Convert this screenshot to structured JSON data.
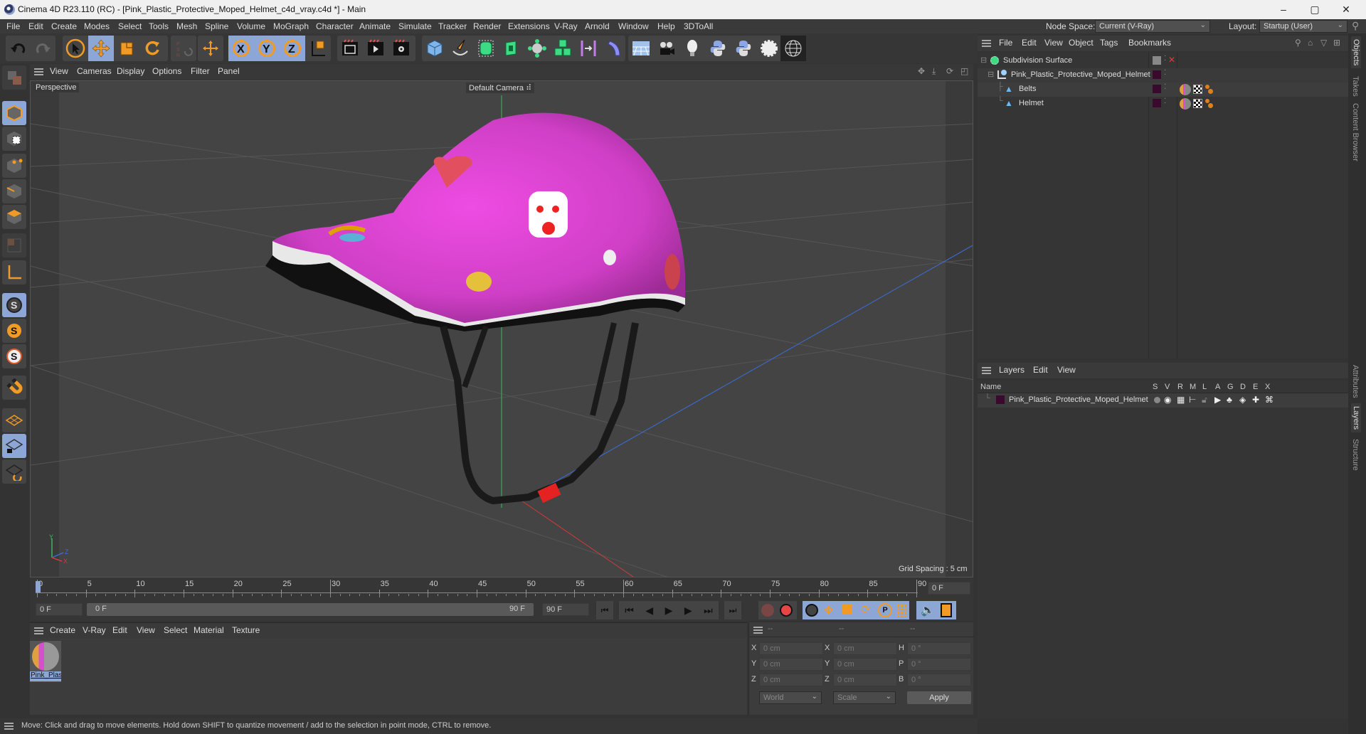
{
  "window": {
    "title": "Cinema 4D R23.110 (RC) - [Pink_Plastic_Protective_Moped_Helmet_c4d_vray.c4d *] - Main",
    "controls": {
      "minimize": "–",
      "maximize": "▢",
      "close": "✕"
    }
  },
  "menubar": {
    "items": [
      "File",
      "Edit",
      "Create",
      "Modes",
      "Select",
      "Tools",
      "Mesh",
      "Spline",
      "Volume",
      "MoGraph",
      "Character",
      "Animate",
      "Simulate",
      "Tracker",
      "Render",
      "Extensions",
      "V-Ray",
      "Arnold",
      "Window",
      "Help",
      "3DToAll"
    ],
    "node_space_label": "Node Space:",
    "node_space_value": "Current (V-Ray)",
    "layout_label": "Layout:",
    "layout_value": "Startup (User)"
  },
  "toolbar": {
    "tools": [
      "undo",
      "redo",
      "live-selection",
      "move",
      "scale",
      "rotate",
      "psr",
      "world-axis",
      "x-axis",
      "y-axis",
      "z-axis",
      "coordinate-system",
      "render-view",
      "render-to-picture-viewer",
      "render-settings",
      "cube",
      "pen",
      "subdivision-surface",
      "extrude",
      "cloner",
      "mograph-array",
      "symmetry",
      "deformer",
      "floor",
      "camera",
      "light",
      "python-1",
      "python-2",
      "settings-gear",
      "sphere-wireframe"
    ],
    "psr_label": "PSR"
  },
  "viewport": {
    "menu": [
      "View",
      "Cameras",
      "Display",
      "Options",
      "Filter",
      "Panel"
    ],
    "view_name": "Perspective",
    "camera_label": "Default Camera",
    "grid_spacing": "Grid Spacing : 5 cm",
    "axis_labels": {
      "x": "X",
      "y": "Y",
      "z": "Z"
    },
    "colors": {
      "helmet": "#d93fd0",
      "strap": "#1a1a1a",
      "buckle": "#e52222",
      "trim": "#e8e8e8"
    }
  },
  "timeline": {
    "ticks": [
      "0",
      "5",
      "10",
      "15",
      "20",
      "25",
      "30",
      "35",
      "40",
      "45",
      "50",
      "55",
      "60",
      "65",
      "70",
      "75",
      "80",
      "85",
      "90"
    ],
    "current_frame_right": "0 F",
    "start_field": "0 F",
    "range_start": "0 F",
    "range_end": "90 F",
    "end_field": "90 F",
    "playhead_value": 0
  },
  "material_manager": {
    "menu": [
      "Create",
      "V-Ray",
      "Edit",
      "View",
      "Select",
      "Material",
      "Texture"
    ],
    "materials": [
      {
        "name": "Pink_Plas"
      }
    ]
  },
  "coordinates": {
    "header": [
      "--",
      "--",
      "--"
    ],
    "position": [
      {
        "axis": "X",
        "value": "0 cm"
      },
      {
        "axis": "Y",
        "value": "0 cm"
      },
      {
        "axis": "Z",
        "value": "0 cm"
      }
    ],
    "size": [
      {
        "axis": "X",
        "value": "0 cm"
      },
      {
        "axis": "Y",
        "value": "0 cm"
      },
      {
        "axis": "Z",
        "value": "0 cm"
      }
    ],
    "rotation": [
      {
        "axis": "H",
        "value": "0 °"
      },
      {
        "axis": "P",
        "value": "0 °"
      },
      {
        "axis": "B",
        "value": "0 °"
      }
    ],
    "mode_select": "World",
    "size_select": "Scale",
    "apply_label": "Apply"
  },
  "status": {
    "text": "Move: Click and drag to move elements. Hold down SHIFT to quantize movement / add to the selection in point mode, CTRL to remove."
  },
  "objects_panel": {
    "menu": [
      "File",
      "Edit",
      "View",
      "Object",
      "Tags",
      "Bookmarks"
    ],
    "tree": [
      {
        "name": "Subdivision Surface",
        "depth": 0,
        "icon": "subdivision-surface-icon"
      },
      {
        "name": "Pink_Plastic_Protective_Moped_Helmet",
        "depth": 1,
        "icon": "null-object-icon"
      },
      {
        "name": "Belts",
        "depth": 2,
        "icon": "polygon-object-icon"
      },
      {
        "name": "Helmet",
        "depth": 2,
        "icon": "polygon-object-icon"
      }
    ]
  },
  "layers_panel": {
    "menu": [
      "Layers",
      "Edit",
      "View"
    ],
    "columns": [
      "Name",
      "S",
      "V",
      "R",
      "M",
      "L",
      "A",
      "G",
      "D",
      "E",
      "X"
    ],
    "layers": [
      {
        "name": "Pink_Plastic_Protective_Moped_Helmet",
        "color": "#3a0a2e"
      }
    ]
  },
  "right_tabs": {
    "top": [
      "Objects",
      "Takes",
      "Content Browser"
    ],
    "bottom": [
      "Attributes",
      "Layers",
      "Structure"
    ]
  }
}
